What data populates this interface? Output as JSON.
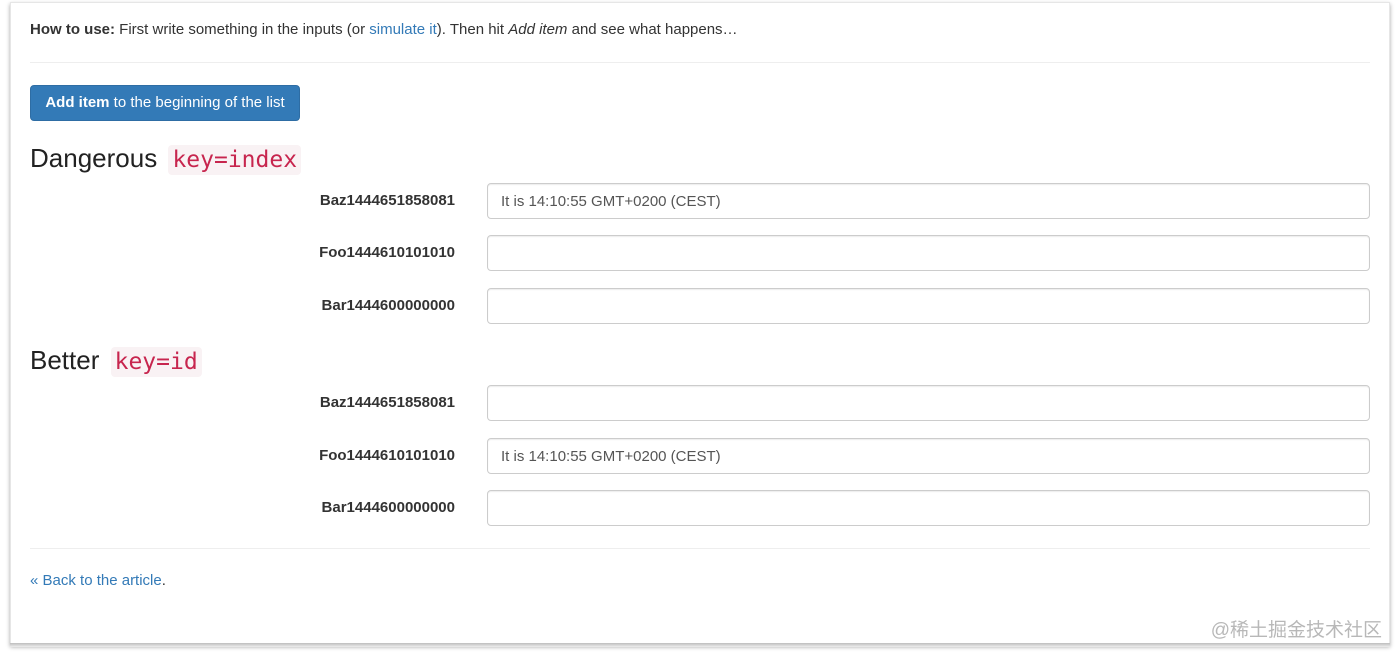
{
  "help": {
    "prefix": "How to use:",
    "text1": " First write something in the inputs (or ",
    "link": "simulate it",
    "text2": "). Then hit ",
    "emph": "Add item",
    "text3": " and see what happens…"
  },
  "add_button": {
    "bold": "Add item",
    "rest": " to the beginning of the list"
  },
  "sections": [
    {
      "title": "Dangerous",
      "code": "key=index",
      "rows": [
        {
          "label": "Baz1444651858081",
          "value": "It is 14:10:55 GMT+0200 (CEST)"
        },
        {
          "label": "Foo1444610101010",
          "value": ""
        },
        {
          "label": "Bar1444600000000",
          "value": ""
        }
      ]
    },
    {
      "title": "Better",
      "code": "key=id",
      "rows": [
        {
          "label": "Baz1444651858081",
          "value": ""
        },
        {
          "label": "Foo1444610101010",
          "value": "It is 14:10:55 GMT+0200 (CEST)"
        },
        {
          "label": "Bar1444600000000",
          "value": ""
        }
      ]
    }
  ],
  "back": {
    "link": "« Back to the article",
    "suffix": "."
  },
  "watermark": "@稀土掘金技术社区",
  "colors": {
    "primary": "#337ab7",
    "code_text": "#c7254e",
    "code_bg": "#f9f2f4"
  }
}
